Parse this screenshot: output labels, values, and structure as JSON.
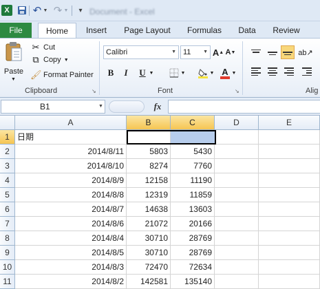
{
  "titlebar": {
    "app_icon": "excel-icon",
    "doc_title": "Document - Excel"
  },
  "tabs": {
    "file": "File",
    "home": "Home",
    "insert": "Insert",
    "page_layout": "Page Layout",
    "formulas": "Formulas",
    "data": "Data",
    "review": "Review"
  },
  "ribbon": {
    "clipboard": {
      "paste": "Paste",
      "cut": "Cut",
      "copy": "Copy",
      "format_painter": "Format Painter",
      "label": "Clipboard"
    },
    "font": {
      "name": "Calibri",
      "size": "11",
      "label": "Font",
      "fill_color": "#f5e33c",
      "font_color": "#e03a2c"
    },
    "alignment": {
      "label": "Alig"
    }
  },
  "formula_bar": {
    "name_box": "B1",
    "fx": "fx",
    "formula": ""
  },
  "sheet": {
    "columns": [
      "A",
      "B",
      "C",
      "D",
      "E"
    ],
    "selected_columns": [
      "B",
      "C"
    ],
    "selected_range": "B1:C1",
    "rows": [
      {
        "n": "1",
        "a": "日期",
        "b": "",
        "c": ""
      },
      {
        "n": "2",
        "a": "2014/8/11",
        "b": "5803",
        "c": "5430"
      },
      {
        "n": "3",
        "a": "2014/8/10",
        "b": "8274",
        "c": "7760"
      },
      {
        "n": "4",
        "a": "2014/8/9",
        "b": "12158",
        "c": "11190"
      },
      {
        "n": "5",
        "a": "2014/8/8",
        "b": "12319",
        "c": "11859"
      },
      {
        "n": "6",
        "a": "2014/8/7",
        "b": "14638",
        "c": "13603"
      },
      {
        "n": "7",
        "a": "2014/8/6",
        "b": "21072",
        "c": "20166"
      },
      {
        "n": "8",
        "a": "2014/8/4",
        "b": "30710",
        "c": "28769"
      },
      {
        "n": "9",
        "a": "2014/8/5",
        "b": "30710",
        "c": "28769"
      },
      {
        "n": "10",
        "a": "2014/8/3",
        "b": "72470",
        "c": "72634"
      },
      {
        "n": "11",
        "a": "2014/8/2",
        "b": "142581",
        "c": "135140"
      }
    ]
  }
}
